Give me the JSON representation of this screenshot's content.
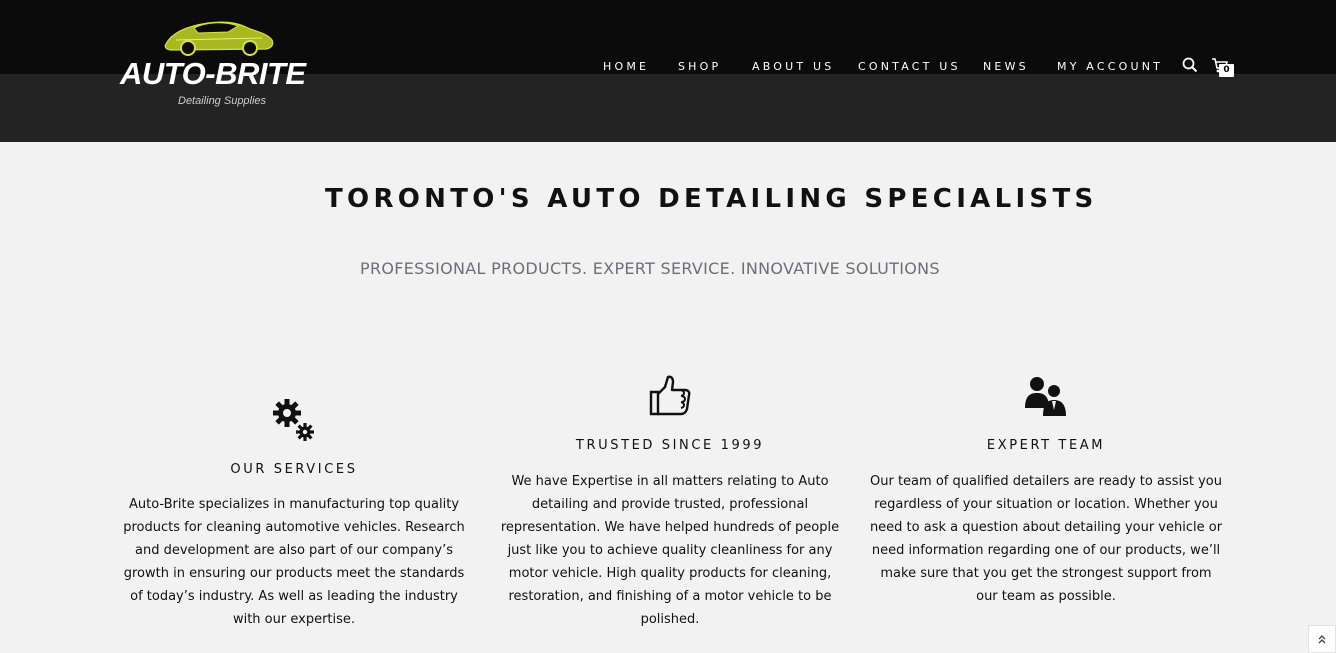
{
  "brand": {
    "name": "AUTO-BRITE",
    "tagline": "Detailing Supplies",
    "accent_color": "#a9b820"
  },
  "nav": {
    "items": [
      {
        "label": "HOME"
      },
      {
        "label": "SHOP"
      },
      {
        "label": "ABOUT US"
      },
      {
        "label": "CONTACT US"
      },
      {
        "label": "NEWS"
      },
      {
        "label": "MY ACCOUNT"
      }
    ],
    "search_icon": "search-icon",
    "cart_icon": "cart-icon",
    "cart_count": "0"
  },
  "hero": {
    "title": "TORONTO'S AUTO DETAILING SPECIALISTS",
    "subtitle": "PROFESSIONAL PRODUCTS. EXPERT SERVICE. INNOVATIVE SOLUTIONS"
  },
  "features": [
    {
      "icon": "gears-icon",
      "title": "OUR SERVICES",
      "text": "Auto-Brite specializes in manufacturing top quality products for cleaning automotive vehicles. Research and development are also part of our company’s growth in ensuring our products meet the standards of today’s industry. As well as leading the industry with our expertise."
    },
    {
      "icon": "thumbs-up-icon",
      "title": "TRUSTED SINCE 1999",
      "text": "We have Expertise in all matters relating to Auto detailing and provide trusted, professional representation. We have helped hundreds of people just like you to achieve quality cleanliness for any motor vehicle. High quality products for cleaning, restoration, and finishing of a motor vehicle to be polished."
    },
    {
      "icon": "team-icon",
      "title": "EXPERT TEAM",
      "text": "Our team of qualified detailers are ready to assist you regardless of your situation or location. Whether you need to ask a question about detailing your vehicle or need information regarding one of our products, we’ll make sure that you get the strongest support from our team as possible."
    }
  ],
  "scroll_top_icon": "double-chevron-up-icon"
}
